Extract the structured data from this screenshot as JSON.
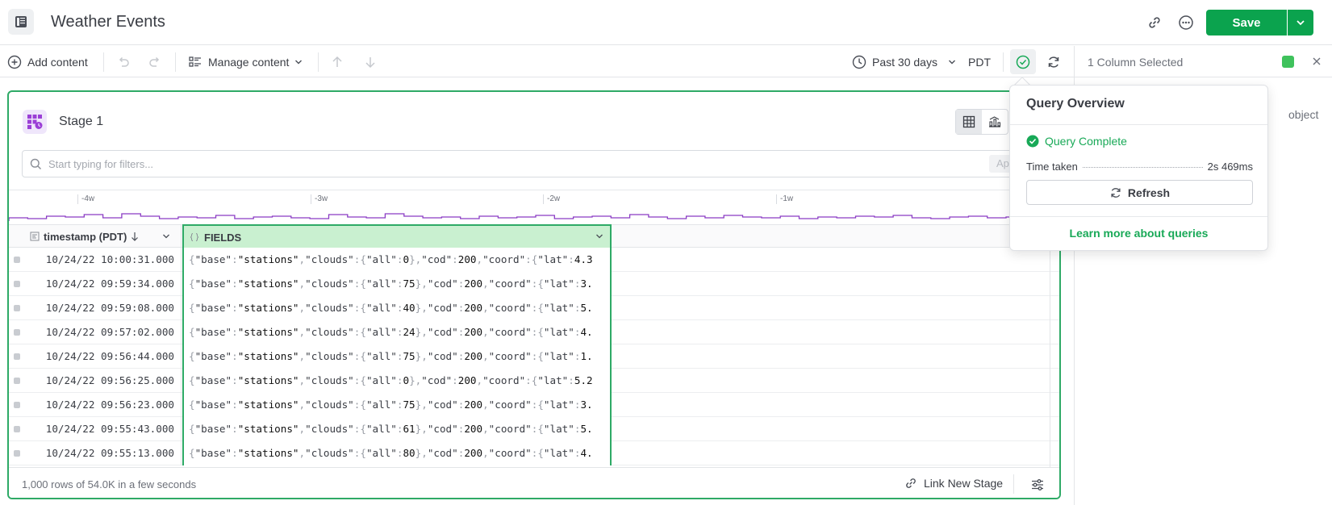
{
  "header": {
    "title": "Weather Events",
    "save_label": "Save"
  },
  "toolbar": {
    "add_content": "Add content",
    "manage_content": "Manage content",
    "time_range": "Past 30 days",
    "timezone": "PDT"
  },
  "right_panel": {
    "title": "1 Column Selected",
    "swatch_color": "#3fc25c",
    "type_value": "object"
  },
  "stage": {
    "title": "Stage 1",
    "filter_placeholder": "Start typing for filters...",
    "apply_label": "Apply",
    "timeline_labels": [
      "-4w",
      "-3w",
      "-2w",
      "-1w"
    ],
    "columns": [
      "timestamp (PDT)",
      "FIELDS"
    ],
    "rows": [
      {
        "ts": "10/24/22 10:00:31.000",
        "all": "0",
        "lat": "4.3"
      },
      {
        "ts": "10/24/22 09:59:34.000",
        "all": "75",
        "lat": "3."
      },
      {
        "ts": "10/24/22 09:59:08.000",
        "all": "40",
        "lat": "5."
      },
      {
        "ts": "10/24/22 09:57:02.000",
        "all": "24",
        "lat": "4."
      },
      {
        "ts": "10/24/22 09:56:44.000",
        "all": "75",
        "lat": "1."
      },
      {
        "ts": "10/24/22 09:56:25.000",
        "all": "0",
        "lat": "5.2"
      },
      {
        "ts": "10/24/22 09:56:23.000",
        "all": "75",
        "lat": "3."
      },
      {
        "ts": "10/24/22 09:55:43.000",
        "all": "61",
        "lat": "5."
      },
      {
        "ts": "10/24/22 09:55:13.000",
        "all": "80",
        "lat": "4."
      }
    ],
    "json_tokens": {
      "base_key": "\"base\"",
      "base_val": "\"stations\"",
      "clouds_key": "\"clouds\"",
      "all_key": "\"all\"",
      "cod_key": "\"cod\"",
      "cod_val": "200",
      "coord_key": "\"coord\"",
      "lat_key": "\"lat\""
    },
    "footer_text": "1,000 rows of 54.0K in a few seconds",
    "link_new_stage": "Link New Stage"
  },
  "popover": {
    "title": "Query Overview",
    "status": "Query Complete",
    "time_label": "Time taken",
    "time_value": "2s 469ms",
    "refresh_label": "Refresh",
    "learn_more": "Learn more about queries"
  },
  "colors": {
    "brand_green": "#0ba34e",
    "success_green": "#18a957",
    "stage_border": "#2eaa66",
    "sparkline": "#8a3bc4"
  }
}
